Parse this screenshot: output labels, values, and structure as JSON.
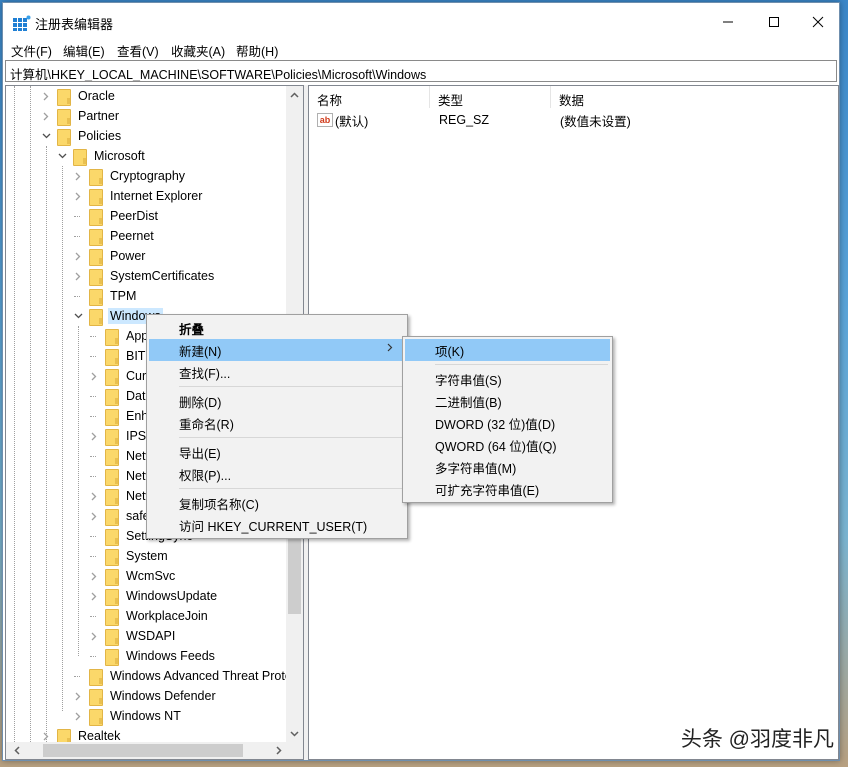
{
  "window": {
    "title": "注册表编辑器",
    "icon": "registry-editor-icon",
    "controls": {
      "minimize": "minimize-icon",
      "maximize": "maximize-icon",
      "close": "close-icon"
    }
  },
  "menubar": {
    "items": [
      {
        "label": "文件(F)"
      },
      {
        "label": "编辑(E)"
      },
      {
        "label": "查看(V)"
      },
      {
        "label": "收藏夹(A)"
      },
      {
        "label": "帮助(H)"
      }
    ]
  },
  "address": {
    "path": "计算机\\HKEY_LOCAL_MACHINE\\SOFTWARE\\Policies\\Microsoft\\Windows"
  },
  "tree": {
    "nodes": [
      {
        "label": "Oracle",
        "level": 1,
        "expander": "collapsed"
      },
      {
        "label": "Partner",
        "level": 1,
        "expander": "collapsed"
      },
      {
        "label": "Policies",
        "level": 1,
        "expander": "expanded"
      },
      {
        "label": "Microsoft",
        "level": 2,
        "expander": "expanded"
      },
      {
        "label": "Cryptography",
        "level": 3,
        "expander": "collapsed"
      },
      {
        "label": "Internet Explorer",
        "level": 3,
        "expander": "collapsed"
      },
      {
        "label": "PeerDist",
        "level": 3,
        "expander": "none"
      },
      {
        "label": "Peernet",
        "level": 3,
        "expander": "none"
      },
      {
        "label": "Power",
        "level": 3,
        "expander": "collapsed"
      },
      {
        "label": "SystemCertificates",
        "level": 3,
        "expander": "collapsed"
      },
      {
        "label": "TPM",
        "level": 3,
        "expander": "none"
      },
      {
        "label": "Windows",
        "level": 3,
        "expander": "expanded",
        "selected": true
      },
      {
        "label": "Appx",
        "level": 4,
        "expander": "none"
      },
      {
        "label": "BITS",
        "level": 4,
        "expander": "none"
      },
      {
        "label": "CurrentVersion",
        "level": 4,
        "expander": "collapsed"
      },
      {
        "label": "DataCollection",
        "level": 4,
        "expander": "none"
      },
      {
        "label": "EnhancedStorageDevices",
        "level": 4,
        "expander": "none"
      },
      {
        "label": "IPSec",
        "level": 4,
        "expander": "collapsed"
      },
      {
        "label": "Network Connections",
        "level": 4,
        "expander": "none"
      },
      {
        "label": "NetworkConnectivityStatusIndicator",
        "level": 4,
        "expander": "none"
      },
      {
        "label": "NetworkProvider",
        "level": 4,
        "expander": "collapsed"
      },
      {
        "label": "safer",
        "level": 4,
        "expander": "collapsed"
      },
      {
        "label": "SettingSync",
        "level": 4,
        "expander": "none"
      },
      {
        "label": "System",
        "level": 4,
        "expander": "none"
      },
      {
        "label": "WcmSvc",
        "level": 4,
        "expander": "collapsed"
      },
      {
        "label": "WindowsUpdate",
        "level": 4,
        "expander": "collapsed"
      },
      {
        "label": "WorkplaceJoin",
        "level": 4,
        "expander": "none"
      },
      {
        "label": "WSDAPI",
        "level": 4,
        "expander": "collapsed"
      },
      {
        "label": "Windows Feeds",
        "level": 4,
        "expander": "none"
      },
      {
        "label": "Windows Advanced Threat Protection",
        "level": 3,
        "expander": "none"
      },
      {
        "label": "Windows Defender",
        "level": 3,
        "expander": "collapsed"
      },
      {
        "label": "Windows NT",
        "level": 3,
        "expander": "collapsed"
      },
      {
        "label": "Realtek",
        "level": 1,
        "expander": "collapsed"
      }
    ],
    "vscroll": {
      "up": "chevron-up-icon",
      "down": "chevron-down-icon"
    },
    "hscroll": {
      "left": "chevron-left-icon",
      "right": "chevron-right-icon"
    }
  },
  "list": {
    "columns": [
      {
        "label": "名称"
      },
      {
        "label": "类型"
      },
      {
        "label": "数据"
      }
    ],
    "rows": [
      {
        "name": "(默认)",
        "type": "REG_SZ",
        "data": "(数值未设置)",
        "icon": "string-value-icon"
      }
    ]
  },
  "context_menu": {
    "items": [
      {
        "label": "折叠",
        "bold": true
      },
      {
        "label": "新建(N)",
        "hover": true,
        "submenu": true
      },
      {
        "label": "查找(F)..."
      },
      {
        "separator": true
      },
      {
        "label": "删除(D)"
      },
      {
        "label": "重命名(R)"
      },
      {
        "separator": true
      },
      {
        "label": "导出(E)"
      },
      {
        "label": "权限(P)..."
      },
      {
        "separator": true
      },
      {
        "label": "复制项名称(C)"
      },
      {
        "label": "访问 HKEY_CURRENT_USER(T)"
      }
    ]
  },
  "submenu": {
    "items": [
      {
        "label": "项(K)",
        "hover": true
      },
      {
        "separator": true
      },
      {
        "label": "字符串值(S)"
      },
      {
        "label": "二进制值(B)"
      },
      {
        "label": "DWORD (32 位)值(D)"
      },
      {
        "label": "QWORD (64 位)值(Q)"
      },
      {
        "label": "多字符串值(M)"
      },
      {
        "label": "可扩充字符串值(E)"
      }
    ]
  },
  "watermark": {
    "text": "头条 @羽度非凡"
  },
  "colors": {
    "menu_hover": "#91c9f7",
    "tree_selected": "#cce8ff",
    "folder": "#fbd86a"
  }
}
